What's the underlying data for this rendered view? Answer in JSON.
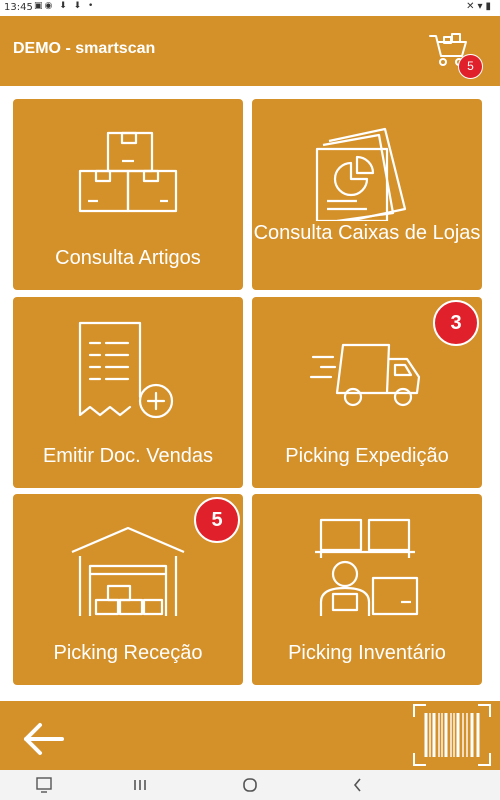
{
  "status_bar": {
    "time": "13:45"
  },
  "header": {
    "title": "DEMO - smartscan",
    "cart_count": "5"
  },
  "tiles": [
    {
      "label": "Consulta Artigos"
    },
    {
      "label": "Consulta Caixas de Lojas"
    },
    {
      "label": "Emitir Doc. Vendas"
    },
    {
      "label": "Picking Expedição",
      "badge": "3"
    },
    {
      "label": "Picking Receção",
      "badge": "5"
    },
    {
      "label": "Picking Inventário"
    }
  ],
  "colors": {
    "accent": "#D4912A",
    "badge": "#E0202A"
  },
  "icons": [
    "boxes-icon",
    "report-document-icon",
    "add-document-icon",
    "delivery-truck-icon",
    "warehouse-icon",
    "inventory-worker-icon",
    "back-arrow-icon",
    "barcode-scanner-icon",
    "cart-icon"
  ]
}
